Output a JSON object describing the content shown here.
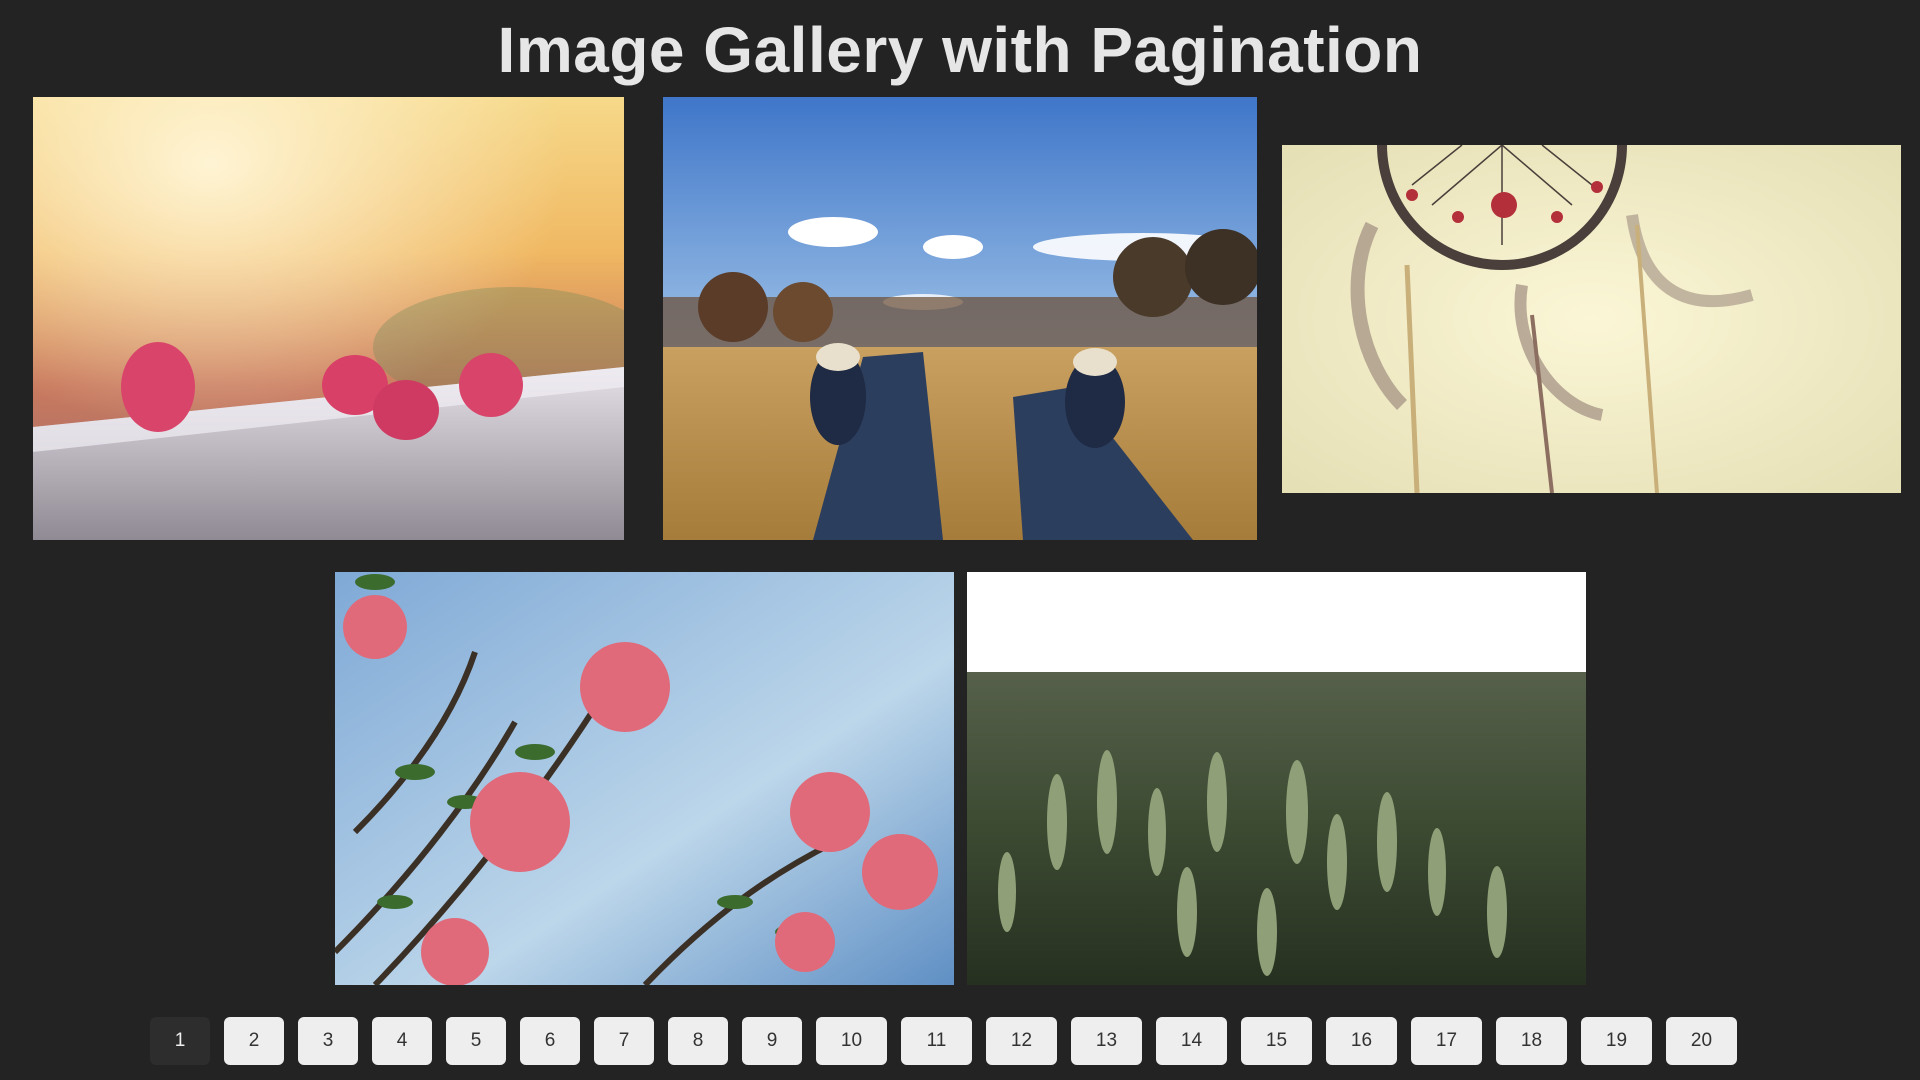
{
  "page": {
    "title": "Image Gallery with Pagination"
  },
  "gallery": {
    "photos": [
      {
        "subject": "raspberries on a wooden rail with warm sunlight"
      },
      {
        "subject": "sneakers on a dry grassy field under blue sky"
      },
      {
        "subject": "dreamcatcher with feathers against pale sky"
      },
      {
        "subject": "pink blossoms on branches against blue sky"
      },
      {
        "subject": "green wheat field close-up"
      }
    ]
  },
  "pagination": {
    "current_page": "1",
    "pages": [
      "1",
      "2",
      "3",
      "4",
      "5",
      "6",
      "7",
      "8",
      "9",
      "10",
      "11",
      "12",
      "13",
      "14",
      "15",
      "16",
      "17",
      "18",
      "19",
      "20"
    ]
  },
  "colors": {
    "background": "#232323",
    "title": "#e6e6e6",
    "page_button": "#eeeeee",
    "page_button_active": "#2d2d2d"
  }
}
